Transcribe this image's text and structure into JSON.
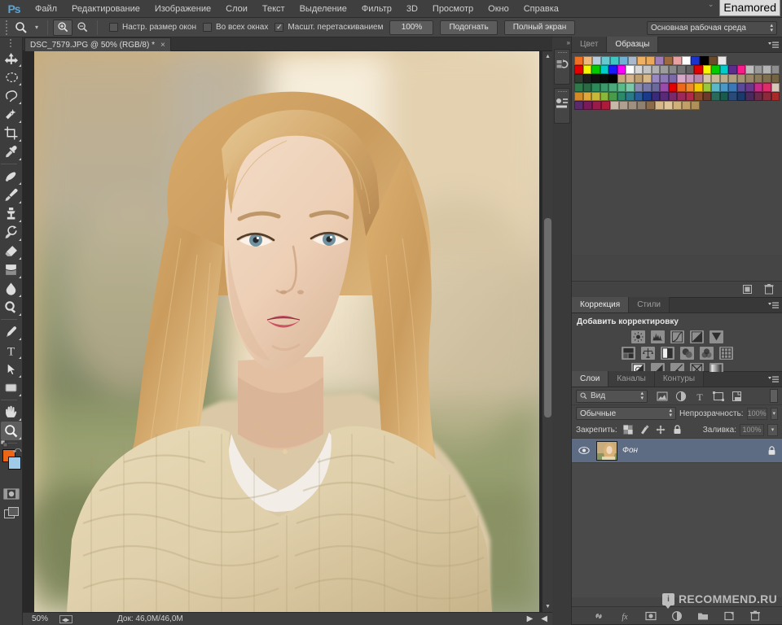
{
  "app": {
    "logo": "Ps",
    "overlay_tooltip": "Enamored"
  },
  "menubar": {
    "items": [
      {
        "label": "Файл"
      },
      {
        "label": "Редактирование"
      },
      {
        "label": "Изображение"
      },
      {
        "label": "Слои"
      },
      {
        "label": "Текст"
      },
      {
        "label": "Выделение"
      },
      {
        "label": "Фильтр"
      },
      {
        "label": "3D"
      },
      {
        "label": "Просмотр"
      },
      {
        "label": "Окно"
      },
      {
        "label": "Справка"
      }
    ]
  },
  "options_bar": {
    "tool": "zoom-tool",
    "zoom_in_label": "+",
    "zoom_out_label": "−",
    "checkboxes": [
      {
        "label": "Настр. размер окон",
        "checked": false
      },
      {
        "label": "Во всех окнах",
        "checked": false
      },
      {
        "label": "Масшт. перетаскиванием",
        "checked": true
      }
    ],
    "buttons": [
      {
        "label": "100%"
      },
      {
        "label": "Подогнать"
      },
      {
        "label": "Полный экран"
      }
    ],
    "workspace": "Основная рабочая среда"
  },
  "toolbar": {
    "tools": [
      {
        "name": "move-tool",
        "selected": false
      },
      {
        "name": "marquee-tool",
        "selected": false
      },
      {
        "name": "lasso-tool",
        "selected": false
      },
      {
        "name": "quick-selection-tool",
        "selected": false
      },
      {
        "name": "crop-tool",
        "selected": false
      },
      {
        "name": "eyedropper-tool",
        "selected": false
      },
      {
        "name": "healing-brush-tool",
        "selected": false
      },
      {
        "name": "brush-tool",
        "selected": false
      },
      {
        "name": "clone-stamp-tool",
        "selected": false
      },
      {
        "name": "history-brush-tool",
        "selected": false
      },
      {
        "name": "eraser-tool",
        "selected": false
      },
      {
        "name": "gradient-tool",
        "selected": false
      },
      {
        "name": "blur-tool",
        "selected": false
      },
      {
        "name": "dodge-tool",
        "selected": false
      },
      {
        "name": "pen-tool",
        "selected": false
      },
      {
        "name": "type-tool",
        "selected": false
      },
      {
        "name": "path-selection-tool",
        "selected": false
      },
      {
        "name": "rectangle-shape-tool",
        "selected": false
      },
      {
        "name": "hand-tool",
        "selected": false
      },
      {
        "name": "zoom-tool",
        "selected": true
      }
    ],
    "foreground_color": "#ec6616",
    "background_color": "#9fcbe8"
  },
  "document": {
    "tab_title": "DSC_7579.JPG @ 50% (RGB/8) *",
    "close_label": "×"
  },
  "statusbar": {
    "zoom": "50%",
    "doc_info": "Док: 46,0M/46,0M"
  },
  "panels": {
    "color_swatches": {
      "tabs": [
        {
          "label": "Цвет",
          "active": false
        },
        {
          "label": "Образцы",
          "active": true
        }
      ],
      "swatch_rows": [
        [
          "#ee7023",
          "#f0b87a",
          "#b9cddd",
          "#67c9cf",
          "#3fc7c2",
          "#6fb2d8",
          "#aab8cc",
          "#f0b061",
          "#e8a95a",
          "#a07cb8",
          "#9b6b3f",
          "#e8a0a0",
          "#ffffff",
          "#1a33cc",
          "#000000",
          "#6b4a2a",
          "#e8e8e8"
        ],
        [
          "#e40000",
          "#f5f500",
          "#00cc00",
          "#00cccc",
          "#1a1aff",
          "#ff00ff",
          "#ffffff",
          "#d8d8d8",
          "#c4c4c4",
          "#b0b0b0",
          "#9c9c9c",
          "#888888",
          "#747474",
          "#606060",
          "#e40000",
          "#f5f500",
          "#00cc00",
          "#00cccc",
          "#5b2d8e",
          "#ff1a8c",
          "#bdbdbd",
          "#9a9a9a",
          "#b4b4b4",
          "#8e8e8e"
        ],
        [
          "#2e3b2e",
          "#1e1e1e",
          "#111111",
          "#0a0a0a",
          "#000000",
          "#c8a87e",
          "#d6b48e",
          "#c0a070",
          "#d8b888",
          "#9a88c0",
          "#8c78b4",
          "#7a68a8",
          "#d8a8c8",
          "#c898bc",
          "#b888ac",
          "#d4c4a8",
          "#c8b898",
          "#bcac8c",
          "#b0a080",
          "#a49474",
          "#988868",
          "#8c7c5c",
          "#807050",
          "#746444"
        ],
        [
          "#2e7a4a",
          "#2a6a44",
          "#2a8a5a",
          "#3a9a6a",
          "#4aaa7a",
          "#5aba8a",
          "#7acaaa",
          "#8a8ab0",
          "#7a7aa8",
          "#6a6a9c",
          "#9a4aaa",
          "#e40000",
          "#ee6a1a",
          "#f08a2a",
          "#f5c800",
          "#9ac83a",
          "#5ab8c8",
          "#4a98c8",
          "#3a78b8",
          "#5a4a9a",
          "#6a3a8a",
          "#c82a8a",
          "#e02a6a",
          "#d8c8b8"
        ],
        [
          "#d08a2a",
          "#e0a83a",
          "#c8b83a",
          "#8ab83a",
          "#4a9a4a",
          "#2a8a6a",
          "#2a7a8a",
          "#2a5a9a",
          "#1a3a8a",
          "#3a2a7a",
          "#5a2a7a",
          "#7a2a6a",
          "#9a2a5a",
          "#b02a4a",
          "#8a4a2a",
          "#6a3a2a",
          "#2a6a5a",
          "#1a5a4a",
          "#2a4a7a",
          "#1a3a6a",
          "#4a2a5a",
          "#6a2a4a",
          "#8a2a3a",
          "#a82a2a"
        ],
        [
          "#5a2a6a",
          "#7a1a5a",
          "#9a1a4a",
          "#b01a3a",
          "#c8b8a8",
          "#b0a090",
          "#a09080",
          "#908070",
          "#8a6a4a",
          "#d8b888",
          "#e0c49a",
          "#d0b078",
          "#c0a068",
          "#b09058"
        ]
      ]
    },
    "adjustments": {
      "tabs": [
        {
          "label": "Коррекция",
          "active": true
        },
        {
          "label": "Стили",
          "active": false
        }
      ],
      "title": "Добавить корректировку",
      "icons": [
        [
          "brightness-contrast-icon",
          "levels-icon",
          "curves-icon",
          "exposure-icon",
          "vibrance-icon"
        ],
        [
          "hue-saturation-icon",
          "color-balance-icon",
          "black-white-icon",
          "photo-filter-icon",
          "channel-mixer-icon",
          "color-lookup-icon"
        ],
        [
          "invert-icon",
          "posterize-icon",
          "threshold-icon",
          "selective-color-icon",
          "gradient-map-icon"
        ]
      ]
    },
    "layers": {
      "tabs": [
        {
          "label": "Слои",
          "active": true
        },
        {
          "label": "Каналы",
          "active": false
        },
        {
          "label": "Контуры",
          "active": false
        }
      ],
      "filter_label": "Вид",
      "filter_icons": [
        "pixel-filter-icon",
        "adjustment-filter-icon",
        "type-filter-icon",
        "shape-filter-icon",
        "smart-object-filter-icon"
      ],
      "blend_mode": "Обычные",
      "opacity_label": "Непрозрачность:",
      "opacity_value": "100%",
      "lock_label": "Закрепить:",
      "lock_icons": [
        "lock-transparent-icon",
        "lock-image-icon",
        "lock-position-icon",
        "lock-all-icon"
      ],
      "fill_label": "Заливка:",
      "fill_value": "100%",
      "rows": [
        {
          "name": "Фон",
          "visible": true,
          "locked": true,
          "selected": true
        }
      ],
      "footer_icons": [
        "link-layers-icon",
        "layer-fx-icon",
        "layer-mask-icon",
        "new-adjustment-icon",
        "new-group-icon",
        "new-layer-icon",
        "delete-layer-icon"
      ]
    }
  },
  "watermark": {
    "text": "RECOMMEND.RU",
    "badge": "i"
  }
}
